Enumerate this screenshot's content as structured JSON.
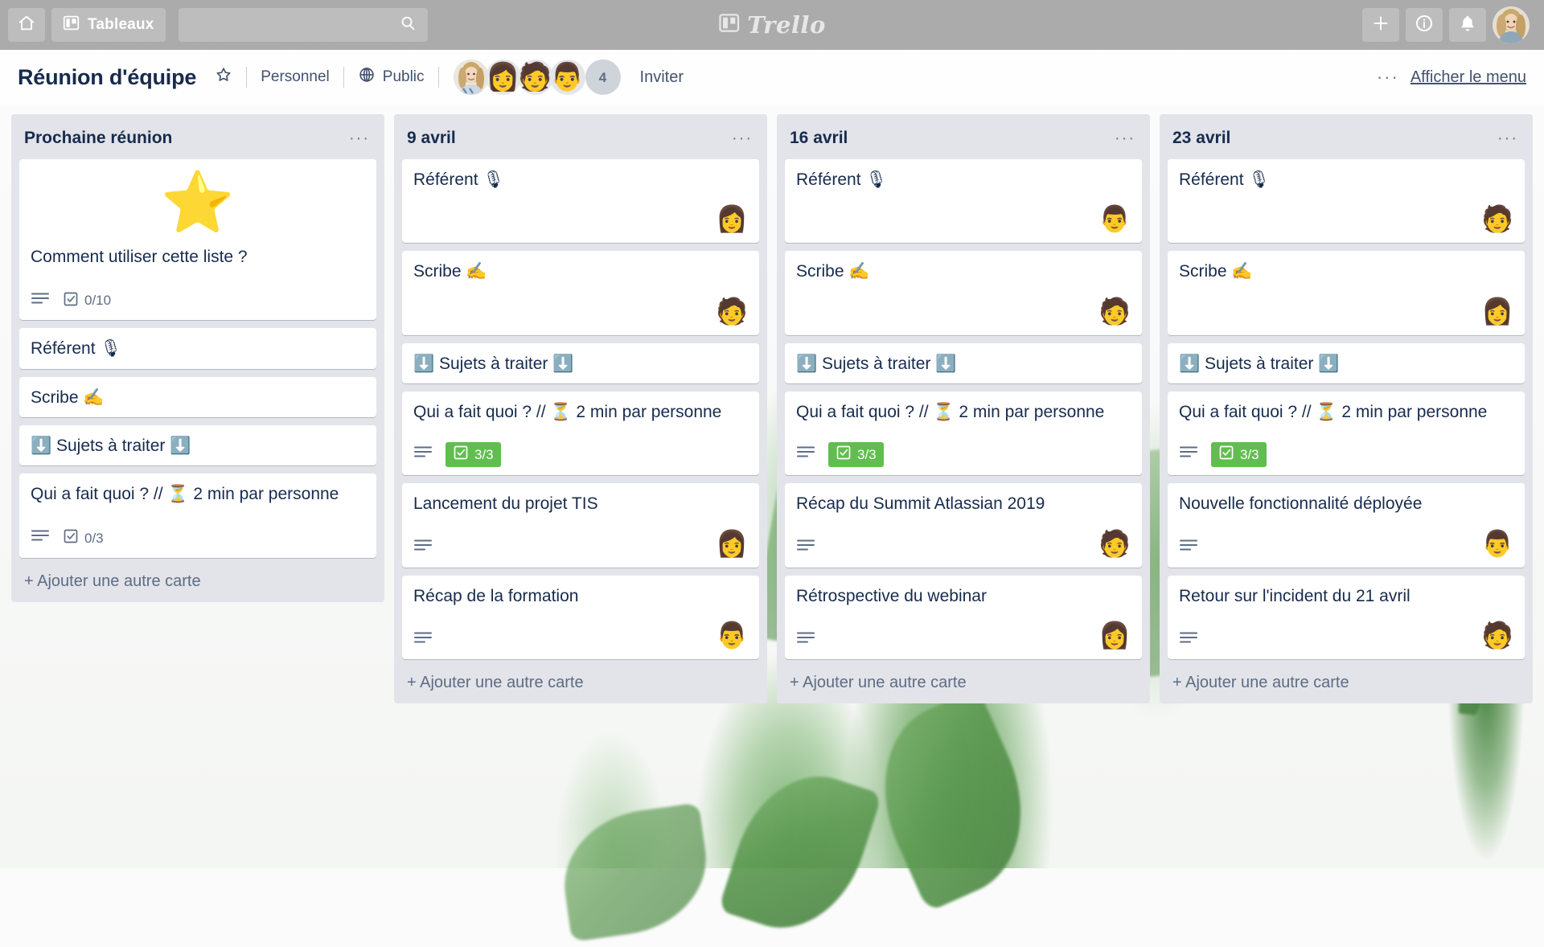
{
  "topbar": {
    "home_icon": "home-icon",
    "boards_label": "Tableaux",
    "boards_icon": "board-icon",
    "search_placeholder": "",
    "search_value": "",
    "search_icon": "search-icon",
    "brand_name": "Trello",
    "brand_icon": "trello-logo-icon",
    "add_icon": "plus-icon",
    "info_icon": "info-icon",
    "notifications_icon": "bell-icon",
    "avatar_icon": "user-avatar-photo"
  },
  "board_header": {
    "title": "Réunion d'équipe",
    "star_icon": "star-outline-icon",
    "visibility_personal": "Personnel",
    "visibility_public": "Public",
    "public_icon": "globe-icon",
    "members": [
      {
        "name": "member-1",
        "glyph": ""
      },
      {
        "name": "member-2",
        "glyph": "👩"
      },
      {
        "name": "member-3",
        "glyph": "🧑"
      },
      {
        "name": "member-4",
        "glyph": "👨"
      }
    ],
    "members_overflow": "4",
    "invite_label": "Inviter",
    "dots_label": "···",
    "show_menu_label": "Afficher le menu"
  },
  "lists": [
    {
      "title": "Prochaine réunion",
      "dots": "···",
      "add_card_label": "+ Ajouter une autre carte",
      "cards": [
        {
          "title": "Comment utiliser cette liste ?",
          "cover_emoji": "⭐",
          "has_description": true,
          "checklist": "0/10",
          "checklist_done": false,
          "member": ""
        },
        {
          "title": "Référent 🎙",
          "has_description": false,
          "checklist": "",
          "member": ""
        },
        {
          "title": "Scribe ✍",
          "has_description": false,
          "checklist": "",
          "member": ""
        },
        {
          "title": "⬇️ Sujets à traiter ⬇️",
          "has_description": false,
          "checklist": "",
          "member": ""
        },
        {
          "title": "Qui a fait quoi ? // ⏳ 2 min par personne",
          "has_description": true,
          "checklist": "0/3",
          "checklist_done": false,
          "member": ""
        }
      ]
    },
    {
      "title": "9 avril",
      "dots": "···",
      "add_card_label": "+ Ajouter une autre carte",
      "cards": [
        {
          "title": "Référent 🎙",
          "has_description": false,
          "checklist": "",
          "member": "👩"
        },
        {
          "title": "Scribe ✍",
          "has_description": false,
          "checklist": "",
          "member": "🧑"
        },
        {
          "title": "⬇️ Sujets à traiter ⬇️",
          "has_description": false,
          "checklist": "",
          "member": ""
        },
        {
          "title": "Qui a fait quoi ? // ⏳ 2 min par personne",
          "has_description": true,
          "checklist": "3/3",
          "checklist_done": true,
          "member": ""
        },
        {
          "title": "Lancement du projet TIS",
          "has_description": true,
          "checklist": "",
          "member": "👩"
        },
        {
          "title": "Récap de la formation",
          "has_description": true,
          "checklist": "",
          "member": "👨"
        }
      ]
    },
    {
      "title": "16 avril",
      "dots": "···",
      "add_card_label": "+ Ajouter une autre carte",
      "cards": [
        {
          "title": "Référent 🎙",
          "has_description": false,
          "checklist": "",
          "member": "👨"
        },
        {
          "title": "Scribe ✍",
          "has_description": false,
          "checklist": "",
          "member": "🧑"
        },
        {
          "title": "⬇️ Sujets à traiter ⬇️",
          "has_description": false,
          "checklist": "",
          "member": ""
        },
        {
          "title": "Qui a fait quoi ? // ⏳ 2 min par personne",
          "has_description": true,
          "checklist": "3/3",
          "checklist_done": true,
          "member": ""
        },
        {
          "title": "Récap du Summit Atlassian 2019",
          "has_description": true,
          "checklist": "",
          "member": "🧑"
        },
        {
          "title": "Rétrospective du webinar",
          "has_description": true,
          "checklist": "",
          "member": "👩"
        }
      ]
    },
    {
      "title": "23 avril",
      "dots": "···",
      "add_card_label": "+ Ajouter une autre carte",
      "cards": [
        {
          "title": "Référent 🎙",
          "has_description": false,
          "checklist": "",
          "member": "🧑"
        },
        {
          "title": "Scribe ✍",
          "has_description": false,
          "checklist": "",
          "member": "👩"
        },
        {
          "title": "⬇️ Sujets à traiter ⬇️",
          "has_description": false,
          "checklist": "",
          "member": ""
        },
        {
          "title": "Qui a fait quoi ? // ⏳ 2 min par personne",
          "has_description": true,
          "checklist": "3/3",
          "checklist_done": true,
          "member": ""
        },
        {
          "title": "Nouvelle fonctionnalité déployée",
          "has_description": true,
          "checklist": "",
          "member": "👨"
        },
        {
          "title": "Retour sur l'incident du 21 avril",
          "has_description": true,
          "checklist": "",
          "member": "🧑"
        }
      ]
    }
  ],
  "colors": {
    "checklist_done_green": "#61bd4f",
    "text_dark": "#172b4d",
    "text_muted": "#5e6c84",
    "list_background": "#e2e4e9"
  }
}
